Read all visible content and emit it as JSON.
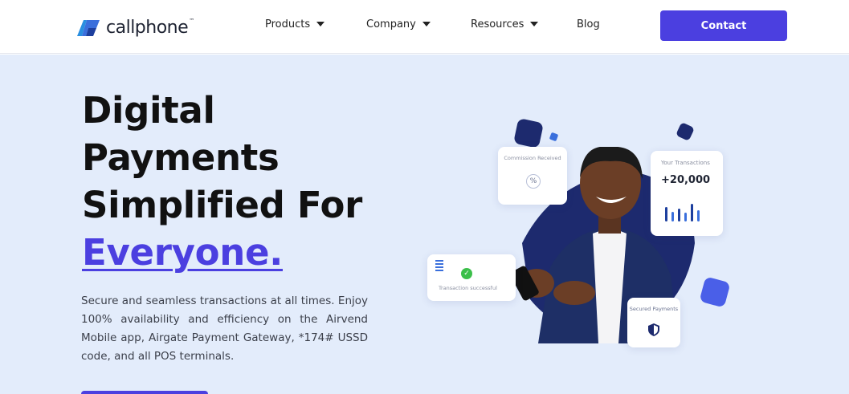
{
  "brand": {
    "name": "callphone",
    "trademark": "™",
    "accent_color": "#4b3fe0",
    "hero_bg_color": "#e3ecfb"
  },
  "nav": {
    "items": [
      {
        "label": "Products",
        "has_dropdown": true
      },
      {
        "label": "Company",
        "has_dropdown": true
      },
      {
        "label": "Resources",
        "has_dropdown": true
      },
      {
        "label": "Blog",
        "has_dropdown": false
      }
    ],
    "contact_label": "Contact"
  },
  "hero": {
    "headline": {
      "line1": "Digital",
      "line2": "Payments",
      "line3": "Simplified For",
      "accent": "Everyone."
    },
    "subtext": "Secure and seamless transactions at all times. Enjoy 100% availability and efficiency on the Airvend Mobile app, Airgate Payment Gateway, *174# USSD code, and all POS terminals."
  },
  "illustration": {
    "commission_card": {
      "label": "Commission Received",
      "icon": "percent-icon"
    },
    "transactions_card": {
      "label": "Your Transactions",
      "value": "+20,000",
      "icon": "bar-chart-icon"
    },
    "success_card": {
      "label": "Transaction successful",
      "icon": "check-icon"
    },
    "secured_card": {
      "label": "Secured Payments",
      "icon": "shield-icon"
    }
  }
}
